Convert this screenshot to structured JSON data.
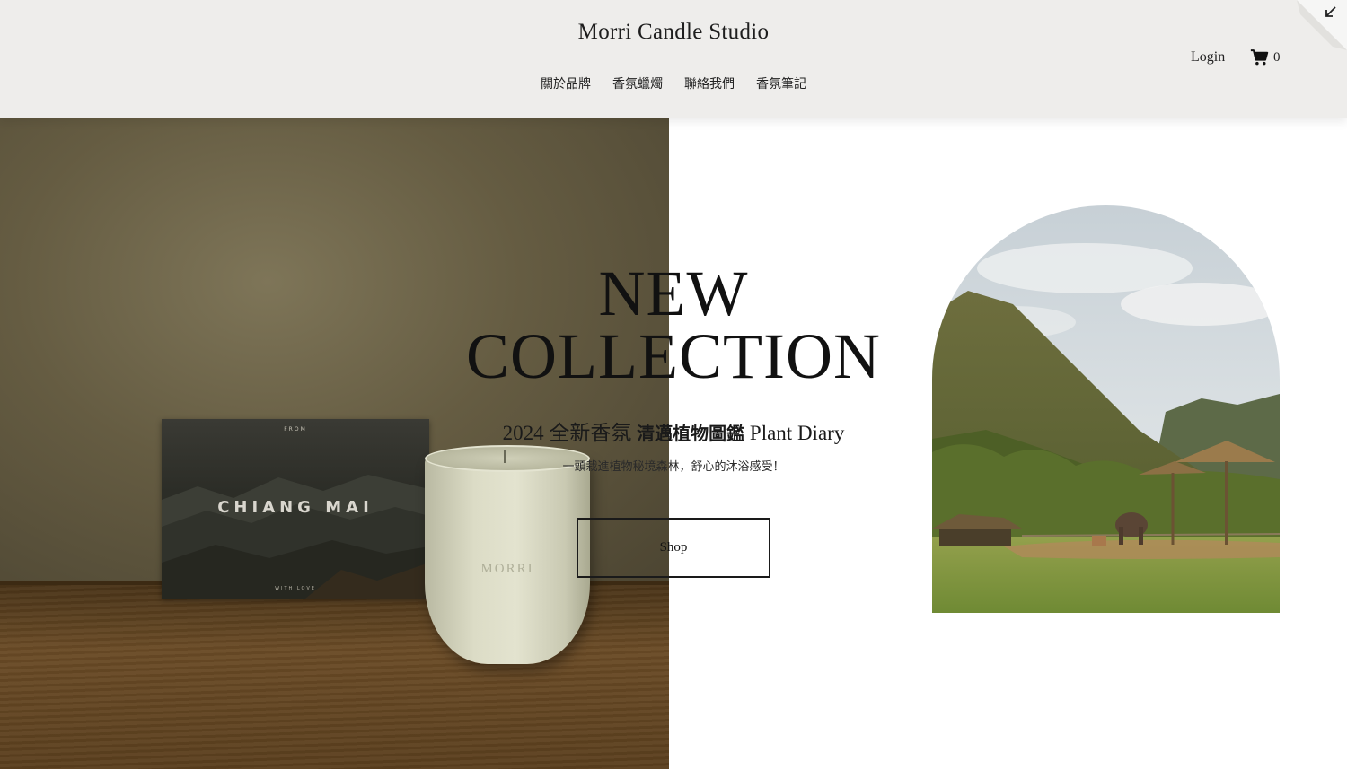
{
  "header": {
    "brand": "Morri Candle Studio",
    "nav": [
      "關於品牌",
      "香氛蠟燭",
      "聯絡我們",
      "香氛筆記"
    ],
    "login_label": "Login",
    "cart_count": "0",
    "cart_icon": "cart-icon",
    "corner_icon": "arrow-down-left-icon"
  },
  "hero": {
    "headline_line1": "NEW",
    "headline_line2": "COLLECTION",
    "subline_prefix": "2024 全新香氛 ",
    "subline_name_zh": "清邁植物圖鑑",
    "subline_name_en": " Plant Diary",
    "description": "一頭栽進植物秘境森林，舒心的沐浴感受！",
    "shop_label": "Shop"
  },
  "photo": {
    "postcard_from": "FROM",
    "postcard_title": "CHIANG MAI",
    "postcard_footer": "WITH LOVE",
    "candle_logo": "MORRI"
  },
  "colors": {
    "header_bg": "#eeedeb",
    "text": "#1c1c1c",
    "button_border": "#1a1a1a"
  }
}
